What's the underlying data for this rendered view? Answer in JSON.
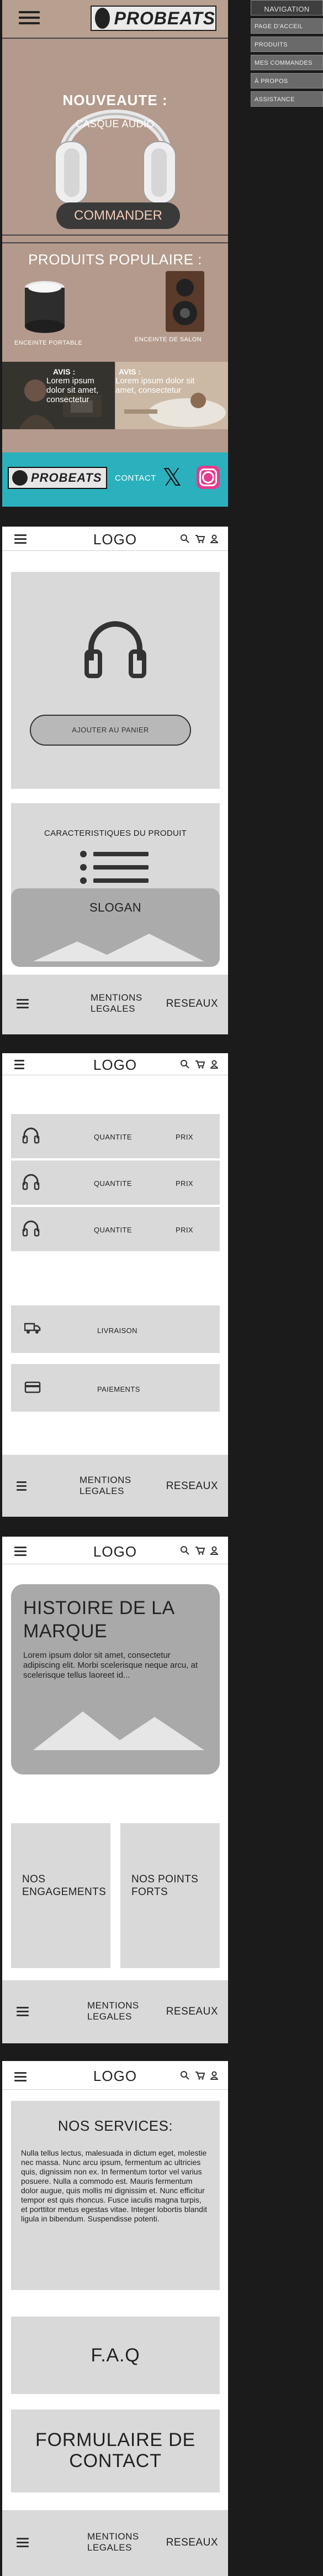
{
  "nav": {
    "title": "NAVIGATION",
    "items": [
      "PAGE D'ACCEIL",
      "PRODUITS",
      "MES COMMANDES",
      "À PROPOS",
      "ASSISTANCE"
    ]
  },
  "mockup": {
    "brand": "PROBEATS",
    "hero_title": "NOUVEAUTE :",
    "hero_subtitle": "CASQUE AUDIO",
    "cta": "COMMANDER",
    "products_title": "PRODUITS POPULAIRE :",
    "product_1": "ENCEINTE PORTABLE",
    "product_2": "ENCEINTE DE SALON",
    "review_1_title": "AVIS :",
    "review_1_text": "Lorem ipsum dolor sit amet, consectetur",
    "review_2_title": "AVIS :",
    "review_2_text": "Lorem ipsum dolor sit amet, consectetur",
    "footer_brand": "PROBEATS",
    "footer_contact": "CONTACT",
    "x_glyph": "𝕏"
  },
  "wire_common": {
    "logo": "LOGO",
    "legal_line1": "MENTIONS",
    "legal_line2": "LEGALES",
    "social": "RESEAUX"
  },
  "page_product": {
    "add_to_cart": "AJOUTER AU PANIER",
    "features": "CARACTERISTIQUES DU PRODUIT",
    "slogan": "SLOGAN"
  },
  "page_cart": {
    "rows": [
      {
        "qty": "QUANTITE",
        "price": "PRIX"
      },
      {
        "qty": "QUANTITE",
        "price": "PRIX"
      },
      {
        "qty": "QUANTITE",
        "price": "PRIX"
      }
    ],
    "delivery": "LIVRAISON",
    "payment": "PAIEMENTS"
  },
  "page_about": {
    "history_line1": "HISTOIRE DE LA",
    "history_line2": "MARQUE",
    "history_text": "Lorem ipsum dolor sit amet, consectetur adipiscing elit. Morbi scelerisque neque arcu, at scelerisque tellus laoreet id...",
    "card_1_line1": "NOS",
    "card_1_line2": "ENGAGEMENTS",
    "card_2_line1": "NOS POINTS",
    "card_2_line2": "FORTS"
  },
  "page_support": {
    "services_title": "NOS SERVICES:",
    "services_text": "Nulla tellus lectus, malesuada in dictum eget, molestie nec massa. Nunc arcu ipsum, fermentum ac ultricies quis, dignissim non ex. In fermentum tortor vel varius posuere. Nulla a commodo est. Mauris fermentum dolor augue, quis mollis mi dignissim et. Nunc efficitur tempor est quis rhoncus. Fusce iaculis magna turpis, et porttitor metus egestas vitae. Integer lobortis blandit ligula in bibendum. Suspendisse potenti.",
    "faq": "F.A.Q",
    "form_line1": "FORMULAIRE DE",
    "form_line2": "CONTACT"
  },
  "colors": {
    "background": "#1b1b1b",
    "mockup_bg": "#b39a8c",
    "mockup_footer": "#2ab1bd",
    "placeholder": "#d9d9d9",
    "placeholder_dark": "#a9a9a9"
  }
}
